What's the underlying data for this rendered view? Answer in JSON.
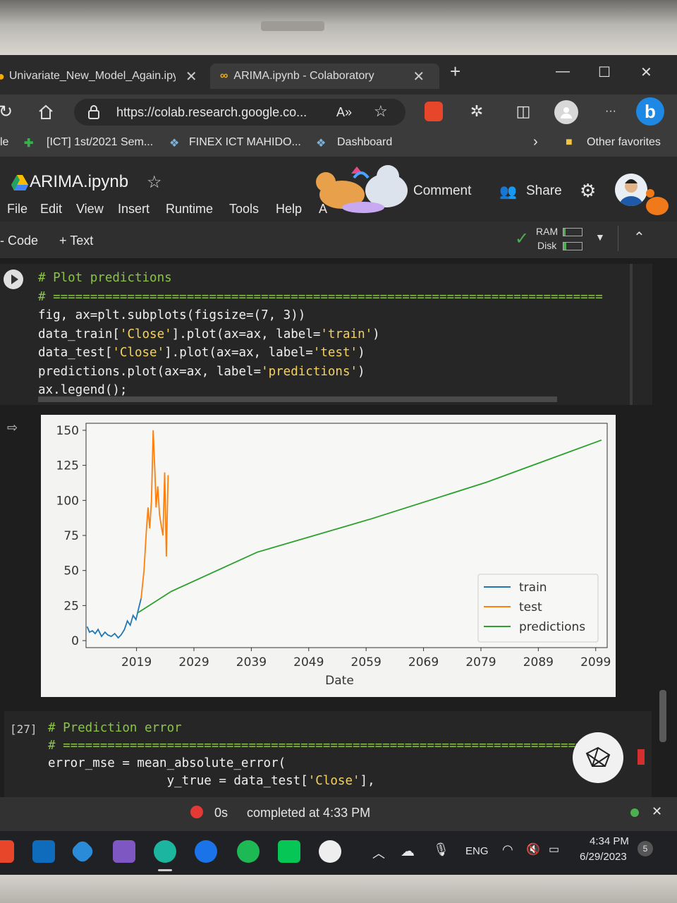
{
  "browser": {
    "tabs": [
      {
        "label": "Univariate_New_Model_Again.ipy",
        "close": "✕"
      },
      {
        "label": "ARIMA.ipynb - Colaboratory",
        "close": "✕"
      }
    ],
    "new_tab": "+",
    "window_controls": [
      "—",
      "☐",
      "✕"
    ],
    "url": "https://colab.research.google.co...",
    "read_aloud": "A»",
    "favorites": [
      {
        "label": "le"
      },
      {
        "label": "[ICT] 1st/2021 Sem..."
      },
      {
        "label": "FINEX ICT MAHIDO..."
      },
      {
        "label": "Dashboard"
      }
    ],
    "other_favorites": "Other favorites",
    "more": "···"
  },
  "colab": {
    "title": "ARIMA.ipynb",
    "menu": [
      "File",
      "Edit",
      "View",
      "Insert",
      "Runtime",
      "Tools",
      "Help",
      "A"
    ],
    "comment": "Comment",
    "share": "Share",
    "toolbar": {
      "code": "- Code",
      "text": "+ Text",
      "ram": "RAM",
      "disk": "Disk"
    }
  },
  "cell1": {
    "lines": [
      {
        "parts": [
          [
            "cm",
            "# Plot predictions"
          ]
        ]
      },
      {
        "parts": [
          [
            "cm",
            "# =========================================================================="
          ]
        ]
      },
      {
        "parts": [
          [
            "df",
            "fig, ax=plt.subplots(figsize=(7, 3))"
          ]
        ]
      },
      {
        "parts": [
          [
            "df",
            "data_train["
          ],
          [
            "st",
            "'Close'"
          ],
          [
            "df",
            "].plot(ax=ax, label="
          ],
          [
            "st",
            "'train'"
          ],
          [
            "df",
            ")"
          ]
        ]
      },
      {
        "parts": [
          [
            "df",
            "data_test["
          ],
          [
            "st",
            "'Close'"
          ],
          [
            "df",
            "].plot(ax=ax, label="
          ],
          [
            "st",
            "'test'"
          ],
          [
            "df",
            ")"
          ]
        ]
      },
      {
        "parts": [
          [
            "df",
            "predictions.plot(ax=ax, label="
          ],
          [
            "st",
            "'predictions'"
          ],
          [
            "df",
            ")"
          ]
        ]
      },
      {
        "parts": [
          [
            "df",
            "ax.legend();"
          ]
        ]
      }
    ]
  },
  "chart_data": {
    "type": "line",
    "xlabel": "Date",
    "ylabel": "",
    "title": "",
    "xticks": [
      "2019",
      "2029",
      "2039",
      "2049",
      "2059",
      "2069",
      "2079",
      "2089",
      "2099"
    ],
    "yticks": [
      0,
      25,
      50,
      75,
      100,
      125,
      150
    ],
    "xlim": [
      2010.2,
      2101
    ],
    "ylim": [
      -5,
      155
    ],
    "legend_position": "lower-right",
    "series": [
      {
        "name": "train",
        "color": "#1f77b4",
        "x": [
          2010.4,
          2010.8,
          2011.3,
          2011.8,
          2012.3,
          2012.9,
          2013.5,
          2014.0,
          2014.6,
          2015.2,
          2015.8,
          2016.3,
          2016.9,
          2017.4,
          2017.9,
          2018.4,
          2018.9,
          2019.3,
          2019.8
        ],
        "y": [
          10,
          6,
          7,
          5,
          8,
          3,
          6,
          4,
          3,
          5,
          2,
          4,
          8,
          14,
          11,
          18,
          15,
          22,
          30
        ]
      },
      {
        "name": "test",
        "color": "#ff7f0e",
        "x": [
          2019.8,
          2020.3,
          2020.7,
          2021.0,
          2021.3,
          2021.6,
          2021.9,
          2022.2,
          2022.4,
          2022.7,
          2023.0,
          2023.3,
          2023.6,
          2023.9,
          2024.2,
          2024.5
        ],
        "y": [
          30,
          50,
          78,
          95,
          80,
          100,
          150,
          120,
          95,
          110,
          90,
          82,
          75,
          120,
          60,
          118
        ]
      },
      {
        "name": "predictions",
        "color": "#2ca02c",
        "x": [
          2019.3,
          2025,
          2040,
          2060,
          2080,
          2100
        ],
        "y": [
          20,
          35,
          63,
          87,
          113,
          143
        ]
      }
    ]
  },
  "cell2": {
    "exec": "[27]",
    "lines": [
      {
        "parts": [
          [
            "cm",
            "# Prediction error"
          ]
        ]
      },
      {
        "parts": [
          [
            "cm",
            "# ======================================================================"
          ]
        ]
      },
      {
        "parts": [
          [
            "df",
            "error_mse = mean_absolute_error("
          ]
        ]
      },
      {
        "parts": [
          [
            "df",
            "                y_true = data_test["
          ],
          [
            "st",
            "'Close'"
          ],
          [
            "df",
            "],"
          ]
        ]
      }
    ]
  },
  "status": {
    "time": "0s",
    "completed": "completed at 4:33 PM"
  },
  "taskbar": {
    "lang": "ENG",
    "clock": "4:34 PM",
    "date": "6/29/2023",
    "badge": "5"
  }
}
